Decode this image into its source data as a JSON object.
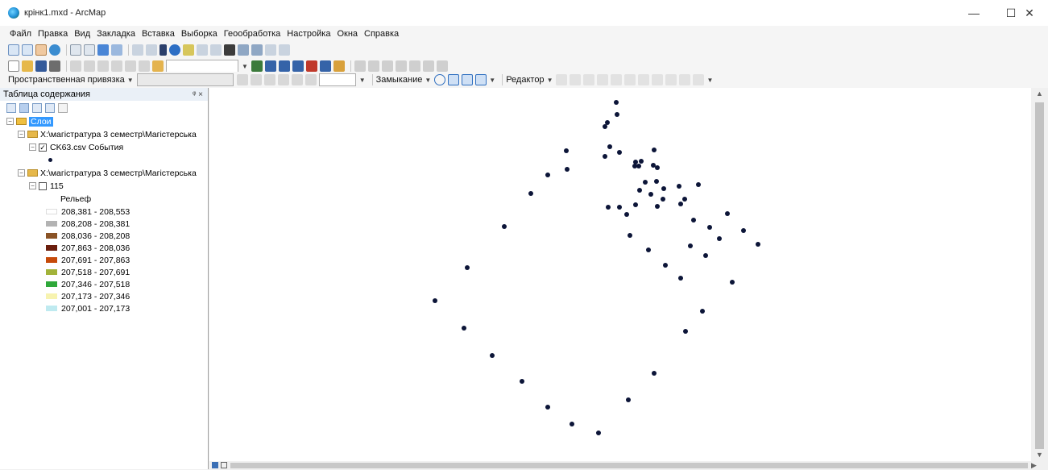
{
  "window": {
    "title": "крінк1.mxd - ArcMap",
    "minimize": "—",
    "maximize": "☐",
    "close": "✕"
  },
  "menu": [
    "Файл",
    "Правка",
    "Вид",
    "Закладка",
    "Вставка",
    "Выборка",
    "Геообработка",
    "Настройка",
    "Окна",
    "Справка"
  ],
  "toolbar3": {
    "spatial_ref_label": "Пространственная привязка",
    "snapping_label": "Замыкание",
    "editor_label": "Редактор"
  },
  "toc": {
    "title": "Таблица содержания",
    "pin": "ᵠ ×",
    "root_label": "Слои",
    "group1_path": "X:\\магістратура 3 семестр\\Магістерська",
    "layer_events": "CK63.csv События",
    "group2_path": "X:\\магістратура 3 семестр\\Магістерська",
    "raster_layer": "115",
    "raster_field": "Рельеф",
    "legend": [
      {
        "label": "208,381 - 208,553",
        "color": "#ffffff"
      },
      {
        "label": "208,208 - 208,381",
        "color": "#b3b3b3"
      },
      {
        "label": "208,036 - 208,208",
        "color": "#8a5326"
      },
      {
        "label": "207,863 - 208,036",
        "color": "#6b1e0d"
      },
      {
        "label": "207,691 - 207,863",
        "color": "#c64a0a"
      },
      {
        "label": "207,518 - 207,691",
        "color": "#a2b33a"
      },
      {
        "label": "207,346 - 207,518",
        "color": "#2fa83a"
      },
      {
        "label": "207,173 - 207,346",
        "color": "#f7f3b0"
      },
      {
        "label": "207,001 - 207,173",
        "color": "#bfeaf0"
      }
    ]
  },
  "map_points": [
    [
      765,
      127
    ],
    [
      766,
      142
    ],
    [
      754,
      152
    ],
    [
      751,
      157
    ],
    [
      703,
      187
    ],
    [
      757,
      182
    ],
    [
      769,
      189
    ],
    [
      751,
      194
    ],
    [
      812,
      186
    ],
    [
      789,
      201
    ],
    [
      796,
      200
    ],
    [
      788,
      206
    ],
    [
      793,
      206
    ],
    [
      811,
      205
    ],
    [
      816,
      208
    ],
    [
      704,
      210
    ],
    [
      680,
      217
    ],
    [
      801,
      226
    ],
    [
      815,
      225
    ],
    [
      843,
      231
    ],
    [
      867,
      229
    ],
    [
      659,
      240
    ],
    [
      794,
      236
    ],
    [
      824,
      234
    ],
    [
      808,
      241
    ],
    [
      850,
      247
    ],
    [
      823,
      247
    ],
    [
      845,
      253
    ],
    [
      755,
      257
    ],
    [
      769,
      257
    ],
    [
      789,
      254
    ],
    [
      778,
      266
    ],
    [
      816,
      256
    ],
    [
      903,
      265
    ],
    [
      861,
      273
    ],
    [
      626,
      281
    ],
    [
      881,
      282
    ],
    [
      923,
      286
    ],
    [
      782,
      292
    ],
    [
      893,
      296
    ],
    [
      941,
      303
    ],
    [
      857,
      305
    ],
    [
      805,
      310
    ],
    [
      876,
      317
    ],
    [
      580,
      332
    ],
    [
      826,
      329
    ],
    [
      845,
      345
    ],
    [
      909,
      350
    ],
    [
      540,
      373
    ],
    [
      872,
      386
    ],
    [
      576,
      407
    ],
    [
      851,
      411
    ],
    [
      611,
      441
    ],
    [
      812,
      463
    ],
    [
      648,
      473
    ],
    [
      780,
      496
    ],
    [
      680,
      505
    ],
    [
      710,
      526
    ],
    [
      743,
      537
    ]
  ],
  "icons": {
    "app": "arcmap-globe-icon",
    "scroll_up": "▲",
    "scroll_down": "▼",
    "scroll_left": "◀",
    "scroll_right": "▶"
  }
}
